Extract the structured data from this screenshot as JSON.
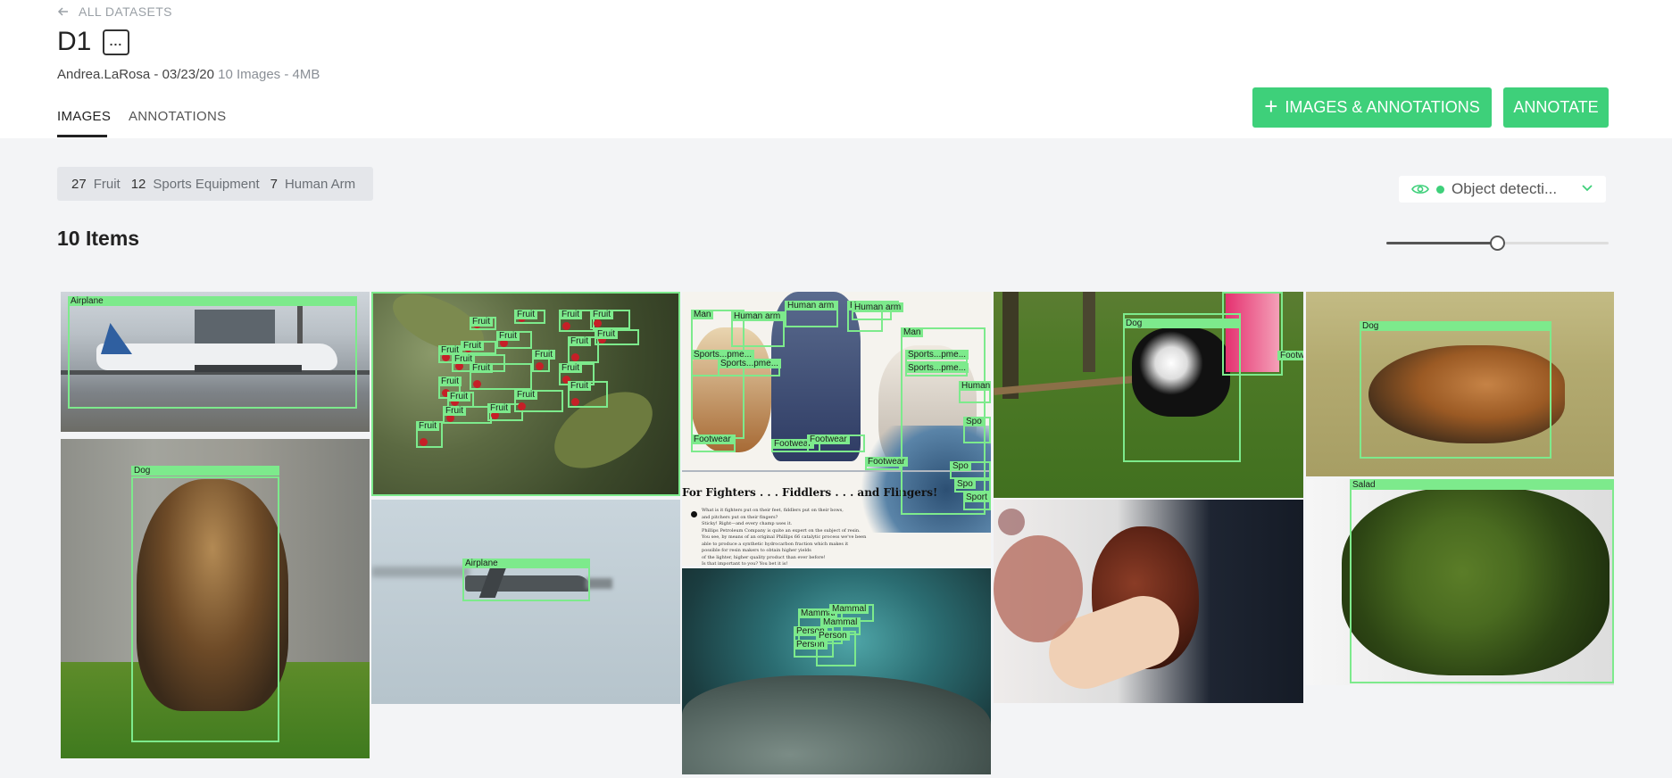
{
  "nav": {
    "back_label": "ALL DATASETS"
  },
  "dataset": {
    "title": "D1",
    "owner_date": "Andrea.LaRosa - 03/23/20",
    "stats": "10 Images - 4MB"
  },
  "tabs": [
    {
      "label": "IMAGES",
      "active": true
    },
    {
      "label": "ANNOTATIONS",
      "active": false
    }
  ],
  "actions": {
    "add_label": "IMAGES & ANNOTATIONS",
    "annotate_label": "ANNOTATE"
  },
  "label_summary": [
    {
      "count": "27",
      "name": "Fruit"
    },
    {
      "count": "12",
      "name": "Sports Equipment"
    },
    {
      "count": "7",
      "name": "Human Arm"
    }
  ],
  "view_select": {
    "value": "Object detecti..."
  },
  "items_count": "10 Items",
  "thumbnail_size": {
    "fraction": 0.5
  },
  "colors": {
    "accent": "#3ed07a",
    "annotation": "#7dea8c",
    "background": "#f3f4f6"
  },
  "images": [
    {
      "name": "airport-plane",
      "labels": [
        "Airplane"
      ]
    },
    {
      "name": "german-shepherd-walking",
      "labels": [
        "Dog"
      ]
    },
    {
      "name": "holly-berries",
      "labels": [
        "Fruit",
        "Fruit",
        "Fruit",
        "Fruit",
        "Fruit",
        "Fruit",
        "Fruit",
        "Fruit",
        "Fruit",
        "Fruit",
        "Fruit",
        "Fruit",
        "Fruit",
        "Fruit",
        "Fruit",
        "Fruit",
        "Fruit",
        "Fruit",
        "Fruit",
        "Fruit"
      ]
    },
    {
      "name": "military-jet",
      "labels": [
        "Airplane"
      ]
    },
    {
      "name": "vintage-fighters-ad",
      "labels": [
        "Man",
        "Human arm",
        "Human arm",
        "Human arm",
        "Human arm",
        "Sports...pme...",
        "Sports...pme...",
        "Man",
        "Sports...pme...",
        "Sports...pme...",
        "Footwear",
        "Footwear",
        "Footwear",
        "Footwear",
        "Human",
        "Spo",
        "Spo",
        "Spo",
        "Sport"
      ]
    },
    {
      "name": "underwater-cave",
      "labels": [
        "Mammal",
        "Mammal",
        "Mammal",
        "Person",
        "Person",
        "Person"
      ]
    },
    {
      "name": "dog-running-grass",
      "labels": [
        "Dog",
        "Footw"
      ]
    },
    {
      "name": "henna-hands",
      "labels": []
    },
    {
      "name": "dog-lying-field",
      "labels": [
        "Dog"
      ]
    },
    {
      "name": "salad-plate",
      "labels": [
        "Salad"
      ]
    }
  ],
  "ad_text": {
    "headline": "For Fighters . . . Fiddlers . . . and Flingers!",
    "body": [
      "What is it fighters put on their feet, fiddlers put on their bows,",
      "and pitchers put on their fingers?",
      "Sticky! Right—and every champ uses it.",
      "Phillips Petroleum Company is quite an expert on the subject of resin.",
      "You see, by means of an original Phillips 66 catalytic process we've been",
      "able to produce a synthetic hydrocarbon fraction which makes it",
      "possible for resin makers to obtain higher yields",
      "of the lighter, higher quality product than ever before!",
      "Is that important to you? You bet it is!"
    ]
  }
}
